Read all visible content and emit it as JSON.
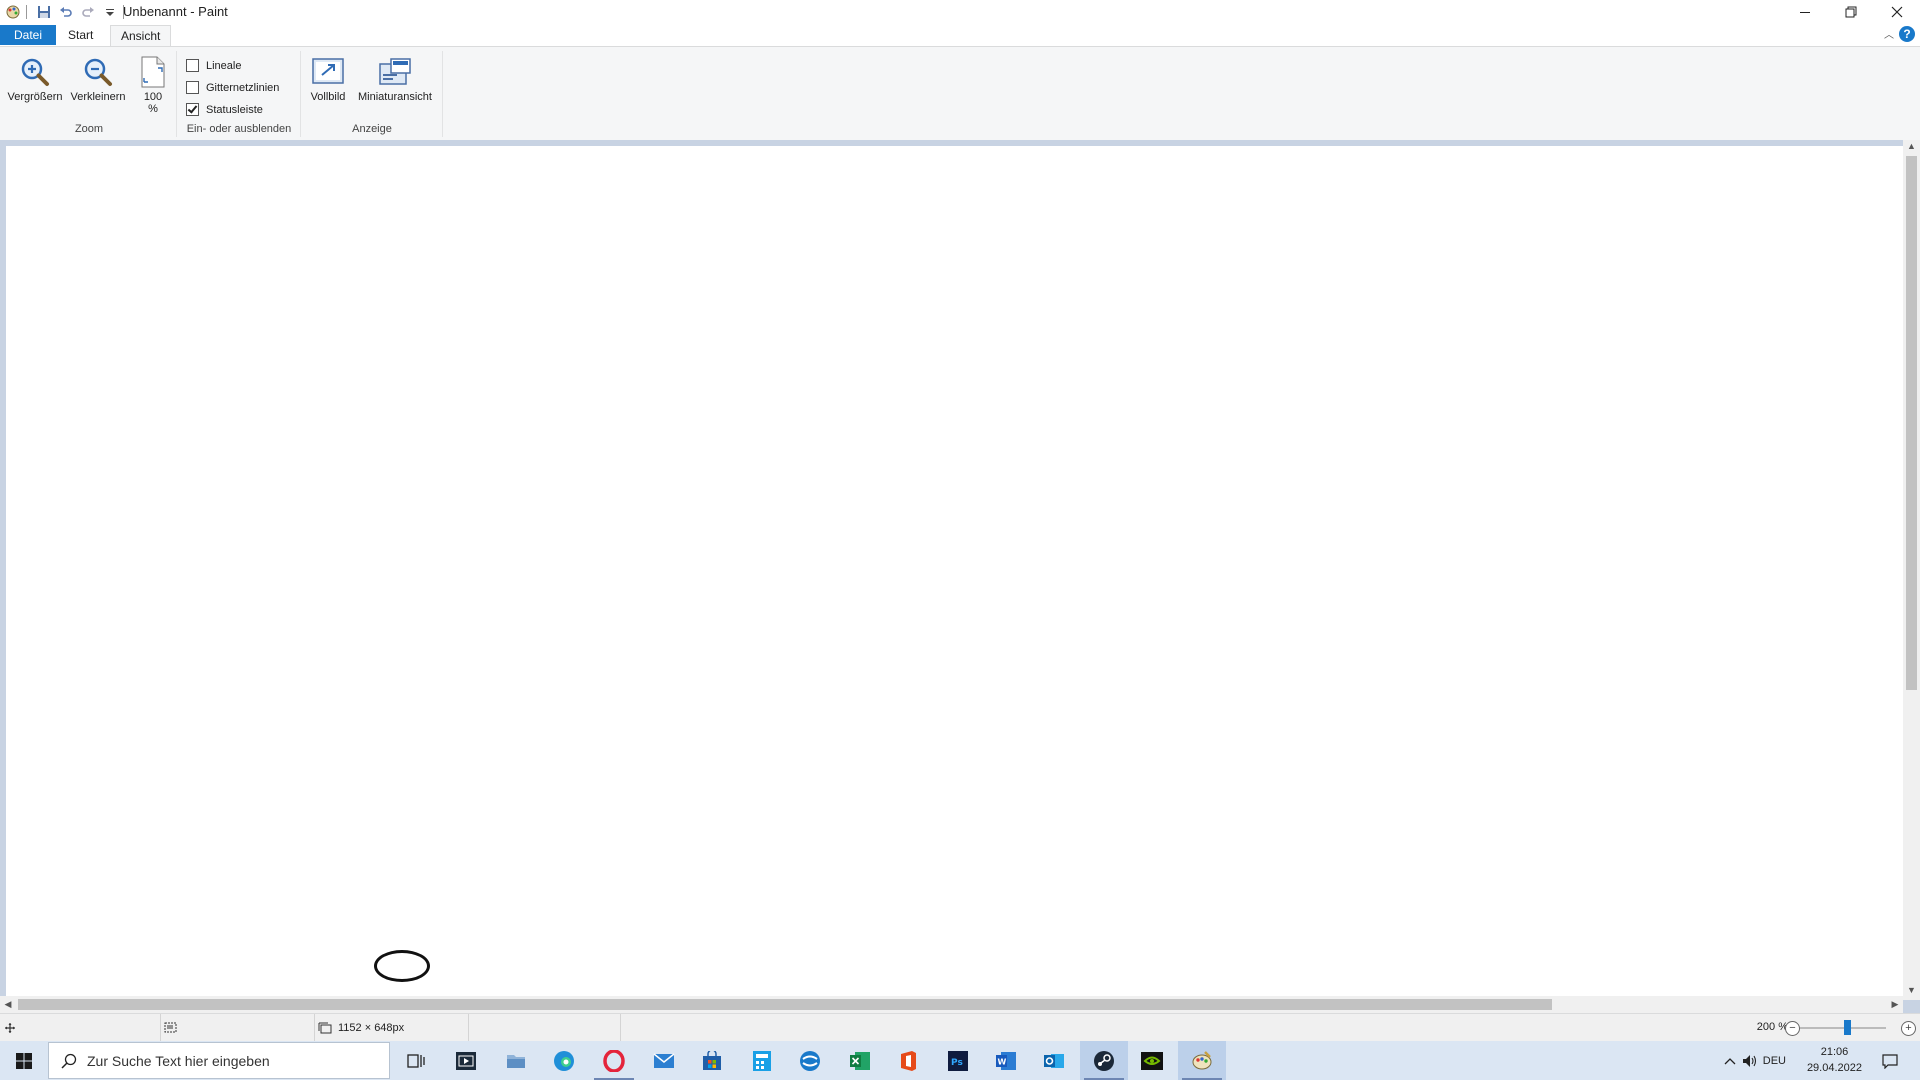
{
  "window": {
    "title": "Unbenannt - Paint"
  },
  "ribbon": {
    "tabs": [
      {
        "label": "Datei"
      },
      {
        "label": "Start"
      },
      {
        "label": "Ansicht"
      }
    ],
    "help_label": "?",
    "groups": {
      "zoom": {
        "label": "Zoom",
        "zoom_in": "Vergrößern",
        "zoom_out": "Verkleinern",
        "zoom_100_line1": "100",
        "zoom_100_line2": "%"
      },
      "toggle": {
        "label": "Ein- oder ausblenden",
        "rulers": {
          "label": "Lineale",
          "checked": false
        },
        "gridlines": {
          "label": "Gitternetzlinien",
          "checked": false
        },
        "statusbar": {
          "label": "Statusleiste",
          "checked": true
        }
      },
      "display": {
        "label": "Anzeige",
        "fullscreen": "Vollbild",
        "thumbnail": "Miniaturansicht"
      }
    }
  },
  "statusbar": {
    "image_size": "1152 × 648px",
    "zoom_level": "200 %",
    "zoom_fraction": 0.56
  },
  "taskbar": {
    "search_placeholder": "Zur Suche Text hier eingeben",
    "language": "DEU",
    "time": "21:06",
    "date": "29.04.2022",
    "apps": [
      "task-view",
      "media-app",
      "file-explorer",
      "edge",
      "opera",
      "mail",
      "store",
      "calculator-app",
      "vpn-app",
      "excel",
      "office",
      "photoshop",
      "word",
      "outlook",
      "steam",
      "nvidia",
      "paint"
    ]
  },
  "colors": {
    "accent": "#1979ca",
    "ribbon_bg": "#f5f6f7",
    "workarea_bg": "#c8d3e3",
    "taskbar_bg": "#dbe6f3"
  }
}
